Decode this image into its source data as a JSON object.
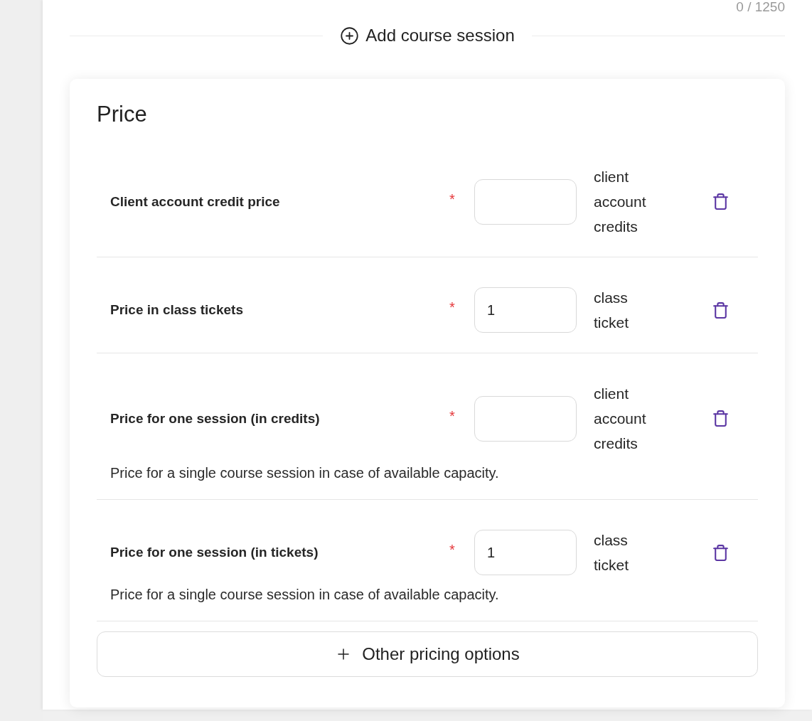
{
  "character_counter": "0 / 1250",
  "add_session_button": {
    "label": "Add course session"
  },
  "price_card": {
    "title": "Price",
    "rows": [
      {
        "label": "Client account credit price",
        "required_mark": "*",
        "unit": "client account credits"
      },
      {
        "label": "Price in class tickets",
        "required_mark": "*",
        "value": "1",
        "unit": "class ticket"
      },
      {
        "label": "Price for one session (in credits)",
        "required_mark": "*",
        "unit": "client account credits",
        "description": "Price for a single course session in case of available capacity."
      },
      {
        "label": "Price for one session (in tickets)",
        "required_mark": "*",
        "value": "1",
        "unit": "class ticket",
        "description": "Price for a single course session in case of available capacity."
      }
    ],
    "other_options_button": {
      "label": "Other pricing options"
    }
  }
}
